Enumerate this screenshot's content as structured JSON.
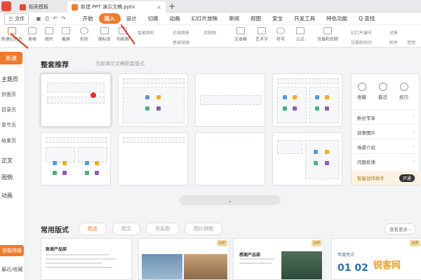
{
  "tabs": [
    {
      "label": "稻壳模板",
      "close": "×"
    },
    {
      "label": "新建 PPT 演示文稿.pptx",
      "close": "×"
    }
  ],
  "new_tab": "+",
  "menu": {
    "file_label": "三 文件",
    "items": [
      "开始",
      "插入",
      "设计",
      "切换",
      "动画",
      "幻灯片放映",
      "审阅",
      "视图",
      "安全",
      "开发工具",
      "特色功能"
    ],
    "active": "插入",
    "search": "Q 查找"
  },
  "ribbon": {
    "items": [
      "新建幻灯片",
      "表格",
      "图片",
      "截屏",
      "形状",
      "图标库",
      "功能图",
      "智能图形",
      "在线图表",
      "流程图",
      "思维导图",
      "文本框",
      "艺术字",
      "符号",
      "公式",
      "页眉和页脚",
      "幻灯片编号",
      "对象",
      "日期和时间",
      "附件",
      "音频"
    ]
  },
  "sidebar": {
    "new_label": "新建",
    "items": [
      "主题页",
      "封面页",
      "目录页",
      "章节页",
      "结束页",
      "正文",
      "图例",
      "动画"
    ],
    "bottom_label": "智能排版",
    "recent": "最近/收藏"
  },
  "section1": {
    "title": "整套推荐",
    "subtitle": "当前演示文稿配套版式"
  },
  "panel": {
    "icons": [
      "收藏",
      "最近",
      "技巧"
    ],
    "rows": [
      "粉丝专享",
      "创意图片",
      "场景介绍",
      "问题反馈"
    ],
    "ai_label": "智能创作助手",
    "ai_button": "开通"
  },
  "more_button": "⌄",
  "section2": {
    "title": "常用版式",
    "chips": [
      "精选",
      "图文",
      "关系图",
      "图片拼图"
    ],
    "view_more": "查看更多 ›"
  },
  "templates": [
    {
      "vip": "VIP",
      "heading": "致谢产品部"
    },
    {
      "vip": "VIP",
      "heading": ""
    },
    {
      "vip": "VIP",
      "heading": "感谢产品部"
    },
    {
      "vip": "VIP",
      "heading": "年度亮点",
      "numbers": "01 02"
    }
  ],
  "watermark": "锐客网",
  "colors": {
    "accent": "#f07b2a",
    "arrow": "#e0302a"
  }
}
